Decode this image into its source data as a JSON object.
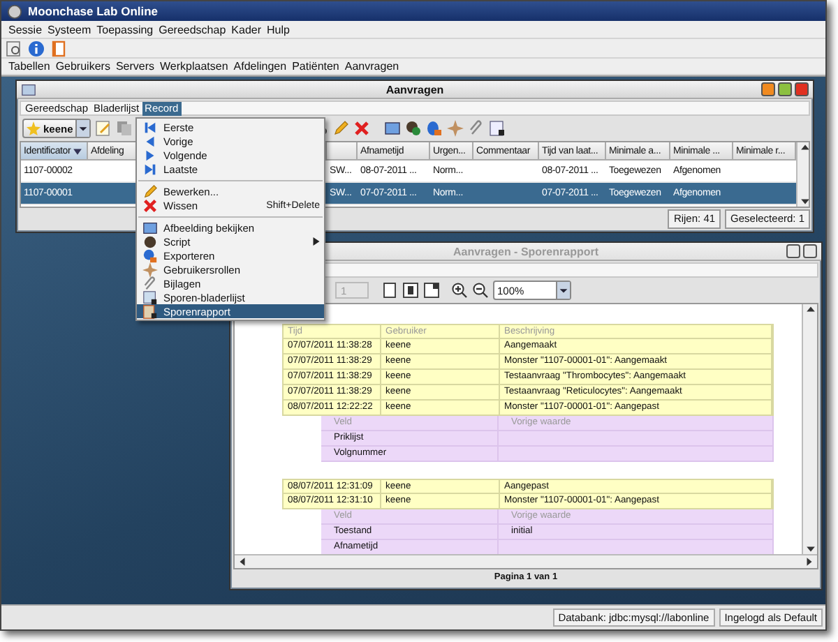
{
  "window": {
    "title": "Moonchase Lab Online"
  },
  "menu_bar": [
    "Sessie",
    "Systeem",
    "Toepassing",
    "Gereedschap",
    "Kader",
    "Hulp"
  ],
  "nav_bar": [
    "Tabellen",
    "Gebruikers",
    "Servers",
    "Werkplaatsen",
    "Afdelingen",
    "Patiënten",
    "Aanvragen"
  ],
  "requests_window": {
    "title": "Aanvragen",
    "menu": [
      {
        "label": "Gereedschap",
        "selected": false
      },
      {
        "label": "Bladerlijst",
        "selected": false
      },
      {
        "label": "Record",
        "selected": true
      }
    ],
    "user_filter": "keene",
    "columns": [
      {
        "label": "Identificator",
        "sorted": true
      },
      {
        "label": "Afdeling",
        "sorted": false
      },
      {
        "sorted": false
      },
      {
        "label": "Afnametijd",
        "sorted": false
      },
      {
        "label": "Urgen...",
        "sorted": false
      },
      {
        "label": "Commentaar",
        "sorted": false
      },
      {
        "label": "Tijd van laat...",
        "sorted": false
      },
      {
        "label": "Minimale a...",
        "sorted": false
      },
      {
        "label": "Minimale ...",
        "sorted": false
      },
      {
        "label": "Minimale r...",
        "sorted": false
      }
    ],
    "rows": [
      {
        "selected": false,
        "cells": [
          "1107-00002",
          null,
          "SW...",
          "08-07-2011 ...",
          "Norm...",
          null,
          "08-07-2011 ...",
          "Toegewezen",
          "Afgenomen",
          null
        ]
      },
      {
        "selected": true,
        "cells": [
          "1107-00001",
          null,
          "SW...",
          "07-07-2011 ...",
          "Norm...",
          null,
          "07-07-2011 ...",
          "Toegewezen",
          "Afgenomen",
          null
        ]
      }
    ],
    "row_count": "Rijen: 41",
    "selected_count": "Geselecteerd: 1"
  },
  "record_menu": [
    {
      "kind": "item",
      "label": "Eerste",
      "selected": false
    },
    {
      "kind": "item",
      "label": "Vorige",
      "selected": false
    },
    {
      "kind": "item",
      "label": "Volgende",
      "selected": false
    },
    {
      "kind": "item",
      "label": "Laatste",
      "selected": false
    },
    {
      "kind": "separator"
    },
    {
      "kind": "item",
      "label": "Bewerken...",
      "selected": false
    },
    {
      "kind": "item",
      "label": "Wissen",
      "shortcut": "Shift+Delete",
      "selected": false
    },
    {
      "kind": "separator"
    },
    {
      "kind": "item",
      "label": "Afbeelding bekijken",
      "selected": false
    },
    {
      "kind": "item",
      "label": "Script",
      "submenu": true,
      "selected": false
    },
    {
      "kind": "item",
      "label": "Exporteren",
      "selected": false
    },
    {
      "kind": "item",
      "label": "Gebruikersrollen",
      "selected": false
    },
    {
      "kind": "item",
      "label": "Bijlagen",
      "selected": false
    },
    {
      "kind": "item",
      "label": "Sporen-bladerlijst",
      "selected": false
    },
    {
      "kind": "item",
      "label": "Sporenrapport",
      "selected": true
    }
  ],
  "report_window": {
    "title": "Aanvragen - Sporenrapport",
    "page": "1",
    "zoom": "100%",
    "columns": [
      "Tijd",
      "Gebruiker",
      "Beschrijving"
    ],
    "groups": [
      {
        "entries": [
          {
            "time": "07/07/2011 11:38:28",
            "user": "keene",
            "description": "Aangemaakt"
          },
          {
            "time": "07/07/2011 11:38:29",
            "user": "keene",
            "description": "Monster \"1107-00001-01\": Aangemaakt"
          },
          {
            "time": "07/07/2011 11:38:29",
            "user": "keene",
            "description": "Testaanvraag \"Thrombocytes\": Aangemaakt"
          },
          {
            "time": "07/07/2011 11:38:29",
            "user": "keene",
            "description": "Testaanvraag \"Reticulocytes\": Aangemaakt"
          },
          {
            "time": "08/07/2011 12:22:22",
            "user": "keene",
            "description": "Monster \"1107-00001-01\": Aangepast",
            "changes": {
              "columns": [
                "Veld",
                "Vorige waarde"
              ],
              "rows": [
                [
                  "Priklijst",
                  null
                ],
                [
                  "Volgnummer",
                  null
                ]
              ]
            }
          }
        ]
      },
      {
        "entries": [
          {
            "time": "08/07/2011 12:31:09",
            "user": "keene",
            "description": "Aangepast"
          },
          {
            "time": "08/07/2011 12:31:10",
            "user": "keene",
            "description": "Monster \"1107-00001-01\": Aangepast",
            "changes": {
              "columns": [
                "Veld",
                "Vorige waarde"
              ],
              "rows": [
                [
                  "Toestand",
                  "initial"
                ],
                [
                  "Afnametijd",
                  null
                ]
              ]
            }
          }
        ]
      }
    ],
    "footer": "Pagina 1 van 1"
  },
  "status_bar": [
    "Databank: jdbc:mysql://labonline",
    "Ingelogd als Default"
  ]
}
